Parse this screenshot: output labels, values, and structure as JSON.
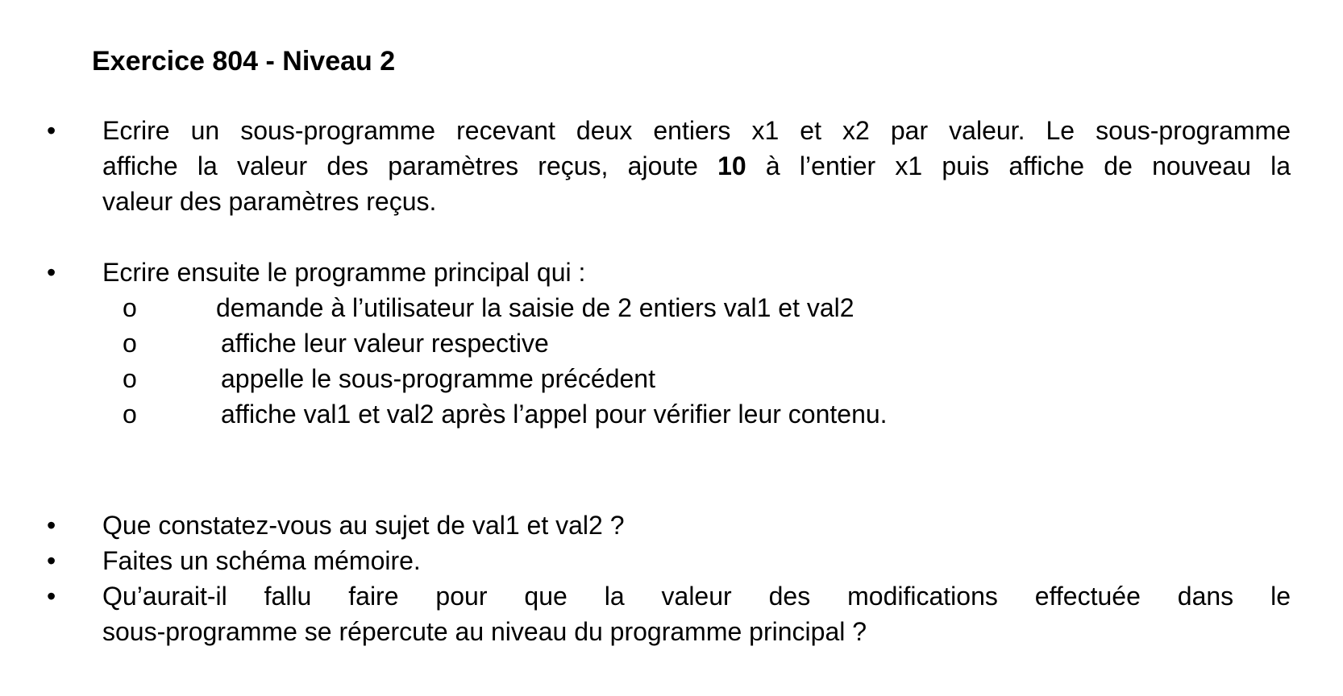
{
  "title": "Exercice 804 - Niveau 2",
  "bullet_symbol": "•",
  "sub_bullet_symbol": "o",
  "item1": {
    "line1": "Ecrire un sous-programme recevant deux entiers x1 et x2 par valeur. Le sous-programme",
    "line2_start": "affiche la valeur des paramètres reçus, ajoute ",
    "line2_bold": "10",
    "line2_end": " à l’entier x1 puis affiche de nouveau la",
    "line3": "valeur des paramètres reçus."
  },
  "item2": {
    "text": "Ecrire ensuite le programme principal qui :",
    "subitems": [
      "demande à l’utilisateur la saisie de 2 entiers val1 et val2",
      "affiche leur valeur respective",
      "appelle le sous-programme précédent",
      "affiche val1 et val2 après l’appel pour vérifier leur contenu."
    ]
  },
  "item3": {
    "text": "Que constatez-vous au sujet de val1 et val2 ?"
  },
  "item4": {
    "text": "Faites un schéma mémoire."
  },
  "item5": {
    "line1": "Qu’aurait-il fallu faire pour que la valeur des modifications effectuée dans le",
    "line2": "sous-programme se répercute au niveau du programme principal ?"
  }
}
